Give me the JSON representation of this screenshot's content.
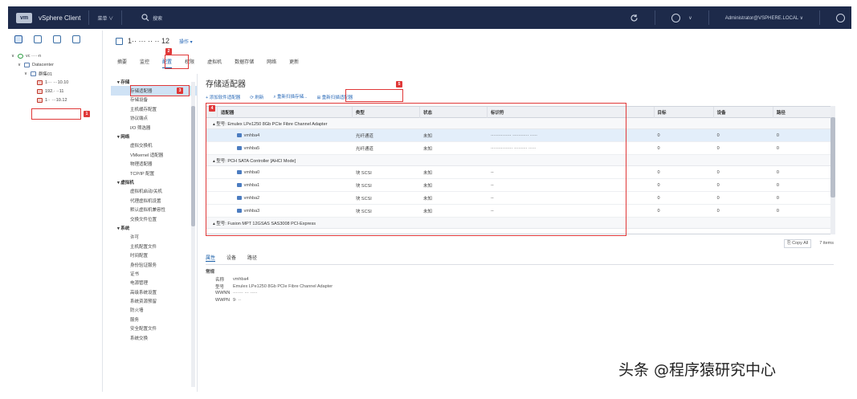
{
  "header": {
    "logo": "vm",
    "app_title": "vSphere Client",
    "menu": "菜单 ∨",
    "search": "搜索",
    "user": "Administrator@VSPHERE.LOCAL ∨"
  },
  "nav": {
    "tree": [
      {
        "label": "vc ·····n",
        "indent": 0,
        "type": "vc"
      },
      {
        "label": "Datacenter",
        "indent": 1,
        "type": "dc"
      },
      {
        "label": "群集01",
        "indent": 2,
        "type": "cluster"
      },
      {
        "label": "1··· ···10.10",
        "indent": 3,
        "type": "host"
      },
      {
        "label": "192.·  ··11",
        "indent": 3,
        "type": "host"
      },
      {
        "label": "1·· ···10.12",
        "indent": 3,
        "type": "host"
      }
    ]
  },
  "object": {
    "title": "1·· ··· ·· ·· 12",
    "actions": "操作 ▾",
    "tabs": [
      "摘要",
      "监控",
      "配置",
      "权限",
      "虚拟机",
      "数据存储",
      "网络",
      "更新"
    ],
    "active_tab": "配置"
  },
  "subnav": [
    {
      "label": "▾ 存储",
      "kind": "cat"
    },
    {
      "label": "存储适配器",
      "kind": "item",
      "selected": true
    },
    {
      "label": "存储设备",
      "kind": "item"
    },
    {
      "label": "主机缓存配置",
      "kind": "item"
    },
    {
      "label": "协议端点",
      "kind": "item"
    },
    {
      "label": "I/O 筛选器",
      "kind": "item"
    },
    {
      "label": "▾ 网络",
      "kind": "cat"
    },
    {
      "label": "虚拟交换机",
      "kind": "item"
    },
    {
      "label": "VMkernel 适配器",
      "kind": "item"
    },
    {
      "label": "物理适配器",
      "kind": "item"
    },
    {
      "label": "TCP/IP 配置",
      "kind": "item"
    },
    {
      "label": "▾ 虚拟机",
      "kind": "cat"
    },
    {
      "label": "虚拟机启动/关机",
      "kind": "item"
    },
    {
      "label": "代理虚拟机设置",
      "kind": "item"
    },
    {
      "label": "默认虚拟机兼容性",
      "kind": "item"
    },
    {
      "label": "交换文件位置",
      "kind": "item"
    },
    {
      "label": "▾ 系统",
      "kind": "cat"
    },
    {
      "label": "许可",
      "kind": "item"
    },
    {
      "label": "主机配置文件",
      "kind": "item"
    },
    {
      "label": "时间配置",
      "kind": "item"
    },
    {
      "label": "身份验证服务",
      "kind": "item"
    },
    {
      "label": "证书",
      "kind": "item"
    },
    {
      "label": "电源管理",
      "kind": "item"
    },
    {
      "label": "高级系统设置",
      "kind": "item"
    },
    {
      "label": "系统资源预留",
      "kind": "item"
    },
    {
      "label": "防火墙",
      "kind": "item"
    },
    {
      "label": "服务",
      "kind": "item"
    },
    {
      "label": "安全配置文件",
      "kind": "item"
    },
    {
      "label": "系统交换",
      "kind": "item"
    }
  ],
  "panel": {
    "title": "存储适配器",
    "toolbar": [
      "+ 添加软件适配器",
      "⟳ 刷新",
      "⌕ 重新扫描存储...",
      "⊞ 重新扫描适配器"
    ],
    "columns": [
      "适配器",
      "类型",
      "状态",
      "标识符",
      "目标",
      "设备",
      "路径"
    ],
    "groups": [
      {
        "label": "▴ 型号: Emulex LPe1250 8Gb PCIe Fibre Channel Adapter",
        "rows": [
          {
            "adapter": "vmhba4",
            "type": "光纤通道",
            "status": "未知",
            "id": "·············· ··········· ·····",
            "targets": "0",
            "devices": "0",
            "paths": "0",
            "selected": true
          },
          {
            "adapter": "vmhba5",
            "type": "光纤通道",
            "status": "未知",
            "id": "··············· ········· ·····",
            "targets": "0",
            "devices": "0",
            "paths": "0"
          }
        ]
      },
      {
        "label": "▴ 型号: PCH SATA Controller [AHCI Mode]",
        "rows": [
          {
            "adapter": "vmhba0",
            "type": "块 SCSI",
            "status": "未知",
            "id": "--",
            "targets": "0",
            "devices": "0",
            "paths": "0"
          },
          {
            "adapter": "vmhba1",
            "type": "块 SCSI",
            "status": "未知",
            "id": "--",
            "targets": "0",
            "devices": "0",
            "paths": "0"
          },
          {
            "adapter": "vmhba2",
            "type": "块 SCSI",
            "status": "未知",
            "id": "--",
            "targets": "0",
            "devices": "0",
            "paths": "0"
          },
          {
            "adapter": "vmhba3",
            "type": "块 SCSI",
            "status": "未知",
            "id": "--",
            "targets": "0",
            "devices": "0",
            "paths": "0"
          }
        ]
      },
      {
        "label": "▴ 型号: Fusion MPT 12GSAS SAS3008 PCI-Express",
        "rows": []
      }
    ],
    "footer_copy": "⎘ Copy All",
    "footer_count": "7 items"
  },
  "details": {
    "tabs": [
      "属性",
      "设备",
      "路径"
    ],
    "active_tab": "属性",
    "section": "常规",
    "props": [
      {
        "k": "名称",
        "v": "vmhba4"
      },
      {
        "k": "型号",
        "v": "Emulex LPe1250 8Gb PCIe Fibre Channel Adapter"
      },
      {
        "k": "WWNN",
        "v": "······· ··· ·····"
      },
      {
        "k": "WWPN",
        "v": "        9·     ··"
      }
    ]
  },
  "annotations": [
    "1",
    "2",
    "3",
    "4",
    "5"
  ],
  "watermark": "头条 @程序猿研究中心",
  "colors": {
    "topbar": "#1d2a4a",
    "accent": "#1a5fa8",
    "callout": "#e03838",
    "selected": "#cfe2f5"
  }
}
